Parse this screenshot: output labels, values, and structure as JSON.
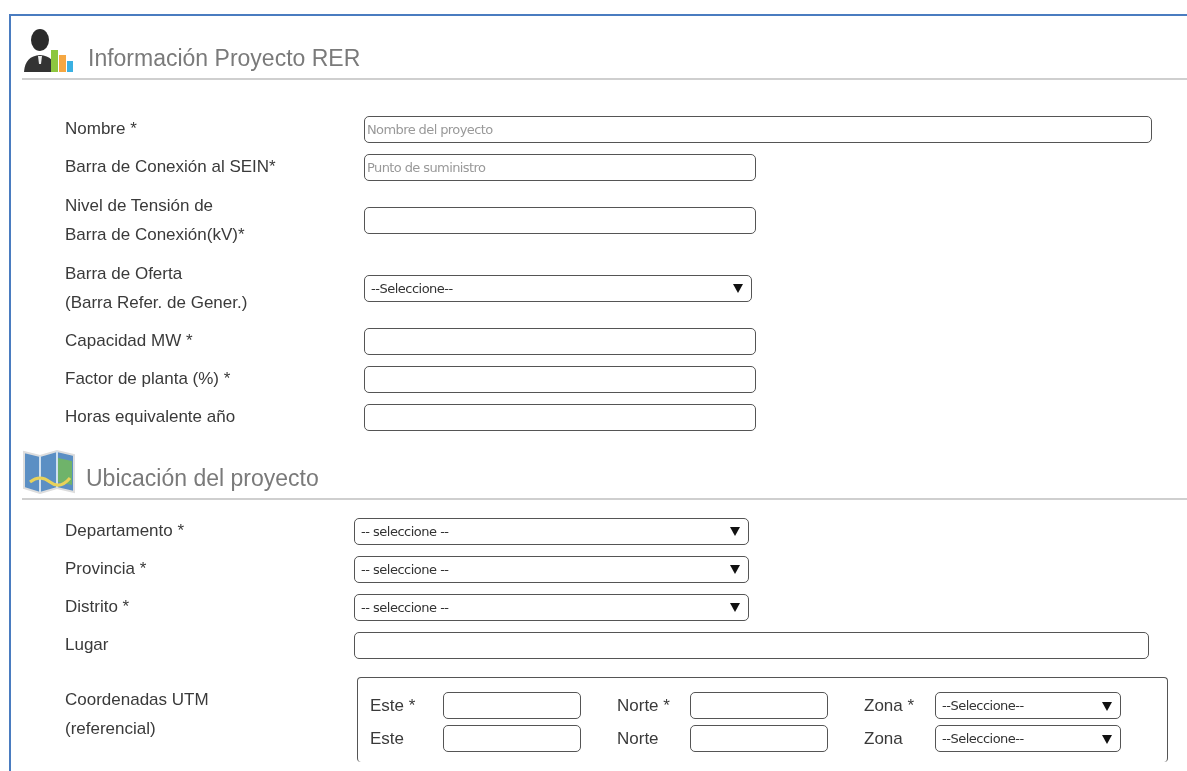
{
  "sections": [
    {
      "kind": "project",
      "title": "Información Proyecto RER",
      "fields": [
        {
          "kind": "long-text",
          "label": [
            "Nombre *"
          ],
          "placeholder": "Nombre del proyecto"
        },
        {
          "kind": "text",
          "label": [
            "Barra de Conexión al SEIN*"
          ],
          "placeholder": "Punto de suministro"
        },
        {
          "kind": "text",
          "label": [
            "Nivel de Tensión de",
            "Barra de Conexión(kV)*"
          ]
        },
        {
          "kind": "select",
          "label": [
            "Barra de Oferta",
            "(Barra Refer. de Gener.)"
          ],
          "value": "--Seleccione--"
        },
        {
          "kind": "text",
          "label": [
            "Capacidad MW *"
          ]
        },
        {
          "kind": "text",
          "label": [
            "Factor de planta (%) *"
          ]
        },
        {
          "kind": "text",
          "label": [
            "Horas equivalente año"
          ]
        }
      ]
    },
    {
      "kind": "location",
      "title": "Ubicación del proyecto",
      "fields": [
        {
          "kind": "select",
          "label": [
            "Departamento *"
          ],
          "value": "-- seleccione --"
        },
        {
          "kind": "select",
          "label": [
            "Provincia *"
          ],
          "value": "-- seleccione --"
        },
        {
          "kind": "select",
          "label": [
            "Distrito *"
          ],
          "value": "-- seleccione --"
        },
        {
          "kind": "long-text",
          "label": [
            "Lugar"
          ]
        },
        {
          "kind": "utm",
          "label": [
            "Coordenadas UTM",
            "(referencial)"
          ],
          "rows": [
            {
              "items": [
                {
                  "kind": "text",
                  "label": "Este *"
                },
                {
                  "kind": "text",
                  "label": "Norte *"
                },
                {
                  "kind": "select",
                  "label": "Zona *",
                  "value": "--Seleccione--"
                }
              ]
            },
            {
              "items": [
                {
                  "kind": "text",
                  "label": "Este"
                },
                {
                  "kind": "text",
                  "label": "Norte"
                },
                {
                  "kind": "select",
                  "label": "Zona",
                  "value": "--Seleccione--"
                }
              ]
            }
          ]
        }
      ]
    }
  ]
}
